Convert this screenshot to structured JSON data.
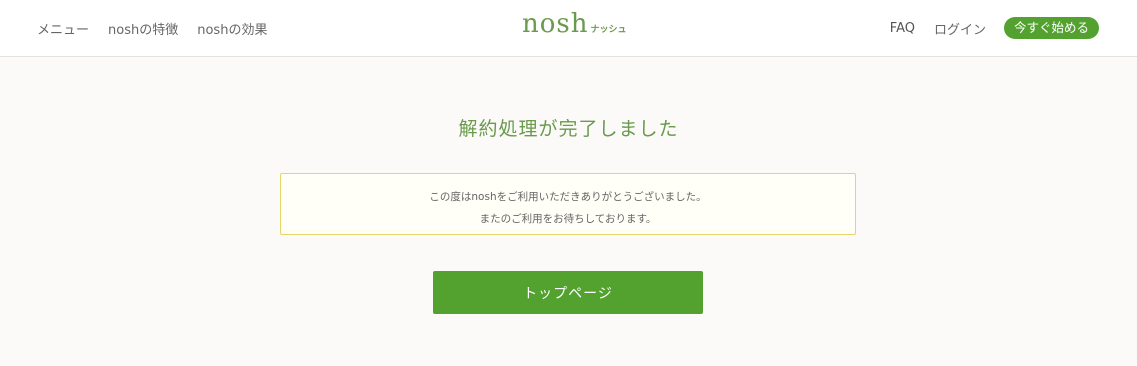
{
  "header": {
    "nav_left": {
      "menu": "メニュー",
      "features": "noshの特徴",
      "effects": "noshの効果"
    },
    "logo": {
      "main": "nosh",
      "sub": "ナッシュ"
    },
    "nav_right": {
      "faq": "FAQ",
      "login": "ログイン",
      "start": "今すぐ始める"
    }
  },
  "main": {
    "title": "解約処理が完了しました",
    "notice": {
      "line1": "この度はnoshをご利用いただきありがとうございました。",
      "line2": "またのご利用をお待ちしております。"
    },
    "top_page_button": "トップページ"
  },
  "colors": {
    "brand_green": "#53a22f",
    "title_green": "#6a9a4c",
    "notice_border": "#e8d56a"
  }
}
